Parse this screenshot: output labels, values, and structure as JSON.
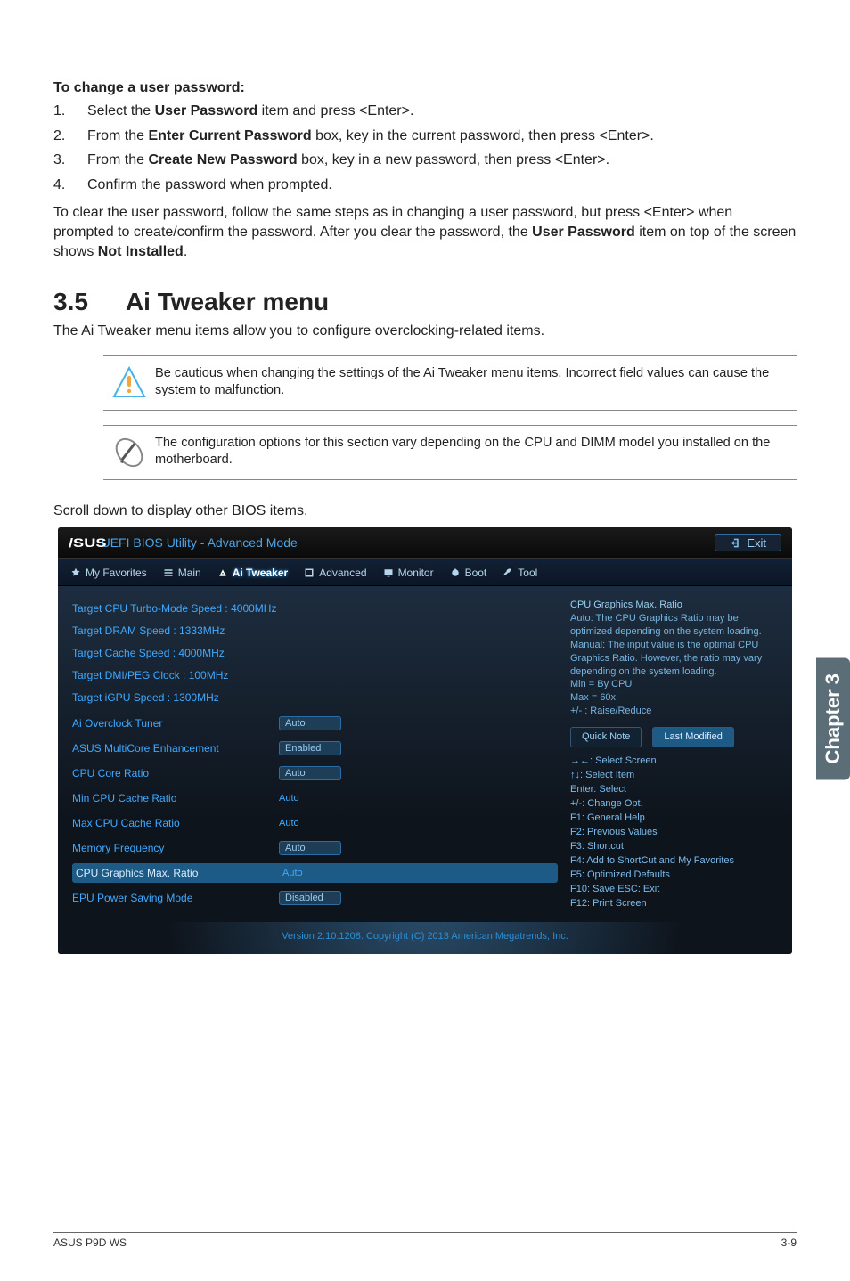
{
  "doc": {
    "changeHeading": "To change a user password:",
    "steps": [
      {
        "num": "1.",
        "parts": [
          {
            "t": "Select the "
          },
          {
            "t": "User Password",
            "b": true
          },
          {
            "t": " item and press <Enter>."
          }
        ]
      },
      {
        "num": "2.",
        "parts": [
          {
            "t": "From the "
          },
          {
            "t": "Enter Current Password",
            "b": true
          },
          {
            "t": " box, key in the current password, then press <Enter>."
          }
        ]
      },
      {
        "num": "3.",
        "parts": [
          {
            "t": "From the "
          },
          {
            "t": "Create New Password",
            "b": true
          },
          {
            "t": " box, key in a new password, then press <Enter>."
          }
        ]
      },
      {
        "num": "4.",
        "parts": [
          {
            "t": "Confirm the password when prompted."
          }
        ]
      }
    ],
    "clearPara": [
      {
        "t": "To clear the user password, follow the same steps as in changing a user password, but press <Enter> when prompted to create/confirm the password. After you clear the password, the "
      },
      {
        "t": "User Password",
        "b": true
      },
      {
        "t": " item on top of the screen shows "
      },
      {
        "t": "Not Installed",
        "b": true
      },
      {
        "t": "."
      }
    ],
    "section": {
      "num": "3.5",
      "title": "Ai Tweaker menu"
    },
    "sectionIntro": "The Ai Tweaker menu items allow you to configure overclocking-related items.",
    "noteCaution": "Be cautious when changing the settings of the Ai Tweaker menu items. Incorrect field values can cause the system to malfunction.",
    "noteConfig": "The configuration options for this section vary depending on the CPU and DIMM model you installed on the motherboard.",
    "scrollPara": "Scroll down to display other BIOS items."
  },
  "bios": {
    "brand": "/SUS",
    "titleRest": " UEFI BIOS Utility - Advanced Mode",
    "exit": "Exit",
    "tabs": [
      "My Favorites",
      "Main",
      "Ai Tweaker",
      "Advanced",
      "Monitor",
      "Boot",
      "Tool"
    ],
    "targets": [
      "Target CPU Turbo-Mode Speed : 4000MHz",
      "Target DRAM Speed : 1333MHz",
      "Target Cache Speed : 4000MHz",
      "Target DMI/PEG Clock : 100MHz",
      "Target iGPU Speed : 1300MHz"
    ],
    "rows": [
      {
        "label": "Ai Overclock Tuner",
        "val": "Auto",
        "type": "pill"
      },
      {
        "label": "ASUS MultiCore Enhancement",
        "val": "Enabled",
        "type": "pill"
      },
      {
        "label": "CPU Core Ratio",
        "val": "Auto",
        "type": "pill"
      },
      {
        "label": "Min CPU Cache Ratio",
        "val": "Auto",
        "type": "plain"
      },
      {
        "label": "Max CPU Cache Ratio",
        "val": "Auto",
        "type": "plain"
      },
      {
        "label": "Memory Frequency",
        "val": "Auto",
        "type": "pill"
      },
      {
        "label": "CPU Graphics Max. Ratio",
        "val": "Auto",
        "type": "plain",
        "selected": true
      },
      {
        "label": "EPU Power Saving Mode",
        "val": "Disabled",
        "type": "pill"
      }
    ],
    "helpTitle": "CPU Graphics Max. Ratio",
    "helpBody": "Auto: The CPU Graphics Ratio may be optimized depending on the system loading.\nManual: The input value is the optimal CPU Graphics Ratio. However, the ratio may vary depending on the system loading.\nMin = By CPU\nMax = 60x\n+/- : Raise/Reduce",
    "quickNote": "Quick Note",
    "lastMod": "Last Modified",
    "hotkeys": [
      "→←: Select Screen",
      "↑↓: Select Item",
      "Enter: Select",
      "+/-: Change Opt.",
      "F1: General Help",
      "F2: Previous Values",
      "F3: Shortcut",
      "F4: Add to ShortCut and My Favorites",
      "F5: Optimized Defaults",
      "F10: Save  ESC: Exit",
      "F12: Print Screen"
    ],
    "footer": "Version 2.10.1208. Copyright (C) 2013 American Megatrends, Inc."
  },
  "sideTab": "Chapter 3",
  "pageFooter": {
    "left": "ASUS P9D WS",
    "right": "3-9"
  }
}
